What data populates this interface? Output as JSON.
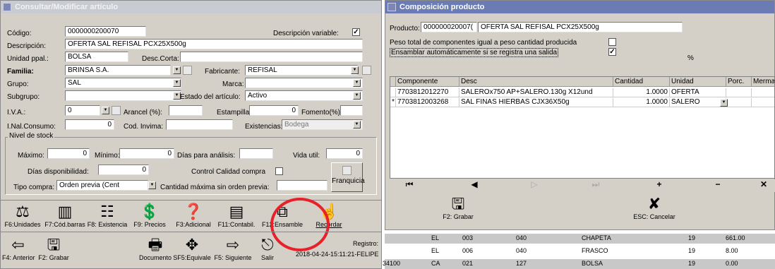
{
  "left": {
    "title": "Consultar/Modificar artículo",
    "codigo_label": "Código:",
    "codigo": "0000000200070",
    "desc_var_label": "Descripción variable:",
    "descripcion_label": "Descripción:",
    "descripcion": "OFERTA SAL REFISAL PCX25X500g",
    "unidad_label": "Unidad ppal.:",
    "unidad": "BOLSA",
    "desc_corta_label": "Desc.Corta:",
    "familia_label": "Familia:",
    "familia": "BRINSA S.A.",
    "fabricante_label": "Fabricante:",
    "fabricante": "REFISAL",
    "grupo_label": "Grupo:",
    "grupo": "SAL",
    "marca_label": "Marca:",
    "subgrupo_label": "Subgrupo:",
    "estado_label": "Estado del artículo:",
    "estado": "Activo",
    "iva_label": "I.V.A.:",
    "iva": "0",
    "arancel_label": "Arancel (%):",
    "estampilla_label": "Estampilla:",
    "fomento": "0",
    "fomento_label": "Fomento(%):",
    "inal_label": "I.Nal.Consumo:",
    "inal": "0",
    "invima_label": "Cod. Invima:",
    "existencias_label": "Existencias:",
    "existencias": "Bodega",
    "nivel_label": "Nivel de stock",
    "maximo_label": "Máximo:",
    "maximo": "0",
    "minimo_label": "Mínimo:",
    "minimo": "0",
    "dias_analisis_label": "Días para análisis:",
    "vida_label": "Vida util:",
    "vida": "0",
    "dias_disp_label": "Días disponibilidad:",
    "dias_disp": "0",
    "control_label": "Control Calidad compra",
    "tipo_label": "Tipo compra:",
    "tipo": "Orden previa (Cent",
    "cant_max_label": "Cantidad máxima sin orden previa:",
    "franquicia": "Franquicia",
    "toolbar": [
      "F6:Unidades",
      "F7:Cód.barras",
      "F8: Existencia",
      "F9: Precios",
      "F3:Adicional",
      "F11:Contabil.",
      "F12:Ensamble",
      "Recordar"
    ],
    "registro_label": "Registro:",
    "registro": "2018-04-24-15:11:21-FELIPE",
    "bottom": [
      "F4: Anterior",
      "F2: Grabar",
      "Documento",
      "SF5:Equivale",
      "F5: Siguiente",
      "Salir"
    ]
  },
  "right": {
    "title": "Composición producto",
    "producto_label": "Producto:",
    "producto_code": "000000020007(",
    "producto_desc": "OFERTA SAL REFISAL PCX25X500g",
    "peso_label": "Peso total de componentes igual a peso cantidad producida",
    "ensamblar_label": "Ensamblar automáticamente si se registra una salida",
    "percent": "%",
    "headers": [
      "Componente",
      "Desc",
      "Cantidad",
      "Unidad",
      "Porc.",
      "Merma"
    ],
    "rows": [
      {
        "comp": "7703812012270",
        "desc": "SALEROx750 AP+SALERO.130g X12und",
        "cant": "1.0000",
        "unid": "OFERTA",
        "marker": ""
      },
      {
        "comp": "7703812003268",
        "desc": "SAL FINAS HIERBAS CJX36X50g",
        "cant": "1.0000",
        "unid": "SALERO",
        "marker": "*"
      }
    ],
    "grabar": "F2: Grabar",
    "cancelar": "ESC: Cancelar",
    "bg_rows": [
      [
        "",
        "EL",
        "003",
        "040",
        "CHAPETA",
        "19",
        "661.00"
      ],
      [
        "",
        "EL",
        "006",
        "040",
        "FRASCO",
        "19",
        "8.00"
      ],
      [
        "34100",
        "CA",
        "021",
        "127",
        "BOLSA",
        "19",
        "0.00"
      ]
    ]
  },
  "colors": {
    "title_active": "#6b7bb3",
    "title_inactive": "#c9cbd3",
    "highlight": "#e8202a",
    "panel": "#d4d0c8"
  }
}
